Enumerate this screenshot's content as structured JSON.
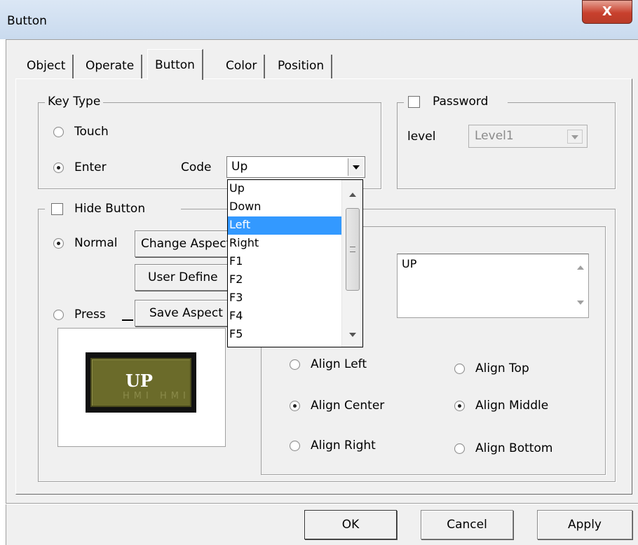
{
  "window": {
    "title": "Button",
    "close_glyph": "X"
  },
  "tabs": [
    "Object",
    "Operate",
    "Button",
    "Color",
    "Position"
  ],
  "key_type": {
    "legend": "Key Type",
    "touch_label": "Touch",
    "enter_label": "Enter",
    "code_label": "Code",
    "code_value": "Up",
    "selected": "Enter"
  },
  "code_dropdown": {
    "options": [
      "Up",
      "Down",
      "Left",
      "Right",
      "F1",
      "F2",
      "F3",
      "F4",
      "F5"
    ],
    "highlighted": "Left"
  },
  "password": {
    "label": "Password",
    "checked": false,
    "level_label": "level",
    "level_value": "Level1"
  },
  "hide_button": {
    "label": "Hide Button",
    "checked": false,
    "normal_label": "Normal",
    "press_label": "Press",
    "selected": "Normal",
    "change_aspect": "Change Aspect",
    "user_define": "User Define",
    "save_aspect": "Save Aspect"
  },
  "preview": {
    "button_text": "UP",
    "watermark": "HMI HMI"
  },
  "text_box": {
    "value": "UP"
  },
  "align": {
    "left": "Align Left",
    "center": "Align Center",
    "right": "Align Right",
    "top": "Align Top",
    "middle": "Align Middle",
    "bottom": "Align Bottom",
    "horizontal_selected": "Align Center",
    "vertical_selected": "Align Middle"
  },
  "footer": {
    "ok": "OK",
    "cancel": "Cancel",
    "apply": "Apply"
  },
  "colors": {
    "preview_face": "#6b6b2a",
    "selection": "#3399ff"
  }
}
